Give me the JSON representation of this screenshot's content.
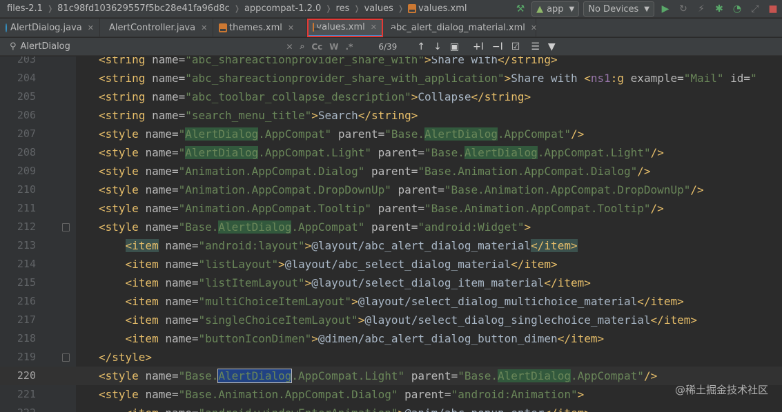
{
  "navbar": {
    "crumbs": [
      "files-2.1",
      "81c98fd103629557f5bc28e41fa96d8c",
      "appcompat-1.2.0",
      "res",
      "values",
      "values.xml"
    ],
    "run_config": "app",
    "device": "No Devices"
  },
  "tabs": [
    {
      "label": "AlertDialog.java",
      "kind": "java"
    },
    {
      "label": "AlertController.java",
      "kind": "java"
    },
    {
      "label": "themes.xml",
      "kind": "xml"
    },
    {
      "label": "values.xml",
      "kind": "xml",
      "active": true
    },
    {
      "label": "abc_alert_dialog_material.xml",
      "kind": "xml"
    }
  ],
  "find": {
    "query": "AlertDialog",
    "match_case": "Cc",
    "words": "W",
    "count": "6/39"
  },
  "lines": [
    {
      "n": "203",
      "code": "<string name=\"abc_shareactionprovider_share_with\">Share with</string>"
    },
    {
      "n": "204",
      "code": "<string name=\"abc_shareactionprovider_share_with_application\">Share with <ns1:g example=\"Mail\" id=\""
    },
    {
      "n": "205",
      "code": "<string name=\"abc_toolbar_collapse_description\">Collapse</string>"
    },
    {
      "n": "206",
      "code": "<string name=\"search_menu_title\">Search</string>"
    },
    {
      "n": "207",
      "code": "<style name=\"AlertDialog.AppCompat\" parent=\"Base.AlertDialog.AppCompat\"/>"
    },
    {
      "n": "208",
      "code": "<style name=\"AlertDialog.AppCompat.Light\" parent=\"Base.AlertDialog.AppCompat.Light\"/>"
    },
    {
      "n": "209",
      "code": "<style name=\"Animation.AppCompat.Dialog\" parent=\"Base.Animation.AppCompat.Dialog\"/>"
    },
    {
      "n": "210",
      "code": "<style name=\"Animation.AppCompat.DropDownUp\" parent=\"Base.Animation.AppCompat.DropDownUp\"/>"
    },
    {
      "n": "211",
      "code": "<style name=\"Animation.AppCompat.Tooltip\" parent=\"Base.Animation.AppCompat.Tooltip\"/>"
    },
    {
      "n": "212",
      "code": "<style name=\"Base.AlertDialog.AppCompat\" parent=\"android:Widget\">"
    },
    {
      "n": "213",
      "code": "    <item name=\"android:layout\">@layout/abc_alert_dialog_material</item>"
    },
    {
      "n": "214",
      "code": "    <item name=\"listLayout\">@layout/abc_select_dialog_material</item>"
    },
    {
      "n": "215",
      "code": "    <item name=\"listItemLayout\">@layout/select_dialog_item_material</item>"
    },
    {
      "n": "216",
      "code": "    <item name=\"multiChoiceItemLayout\">@layout/select_dialog_multichoice_material</item>"
    },
    {
      "n": "217",
      "code": "    <item name=\"singleChoiceItemLayout\">@layout/select_dialog_singlechoice_material</item>"
    },
    {
      "n": "218",
      "code": "    <item name=\"buttonIconDimen\">@dimen/abc_alert_dialog_button_dimen</item>"
    },
    {
      "n": "219",
      "code": "</style>"
    },
    {
      "n": "220",
      "code": "<style name=\"Base.AlertDialog.AppCompat.Light\" parent=\"Base.AlertDialog.AppCompat\"/>"
    },
    {
      "n": "221",
      "code": "<style name=\"Base.Animation.AppCompat.Dialog\" parent=\"android:Animation\">"
    },
    {
      "n": "222",
      "code": "    <item name=\"android:windowEnterAnimation\">@anim/abc_popup_enter</item>"
    }
  ],
  "watermark": "@稀土掘金技术社区"
}
